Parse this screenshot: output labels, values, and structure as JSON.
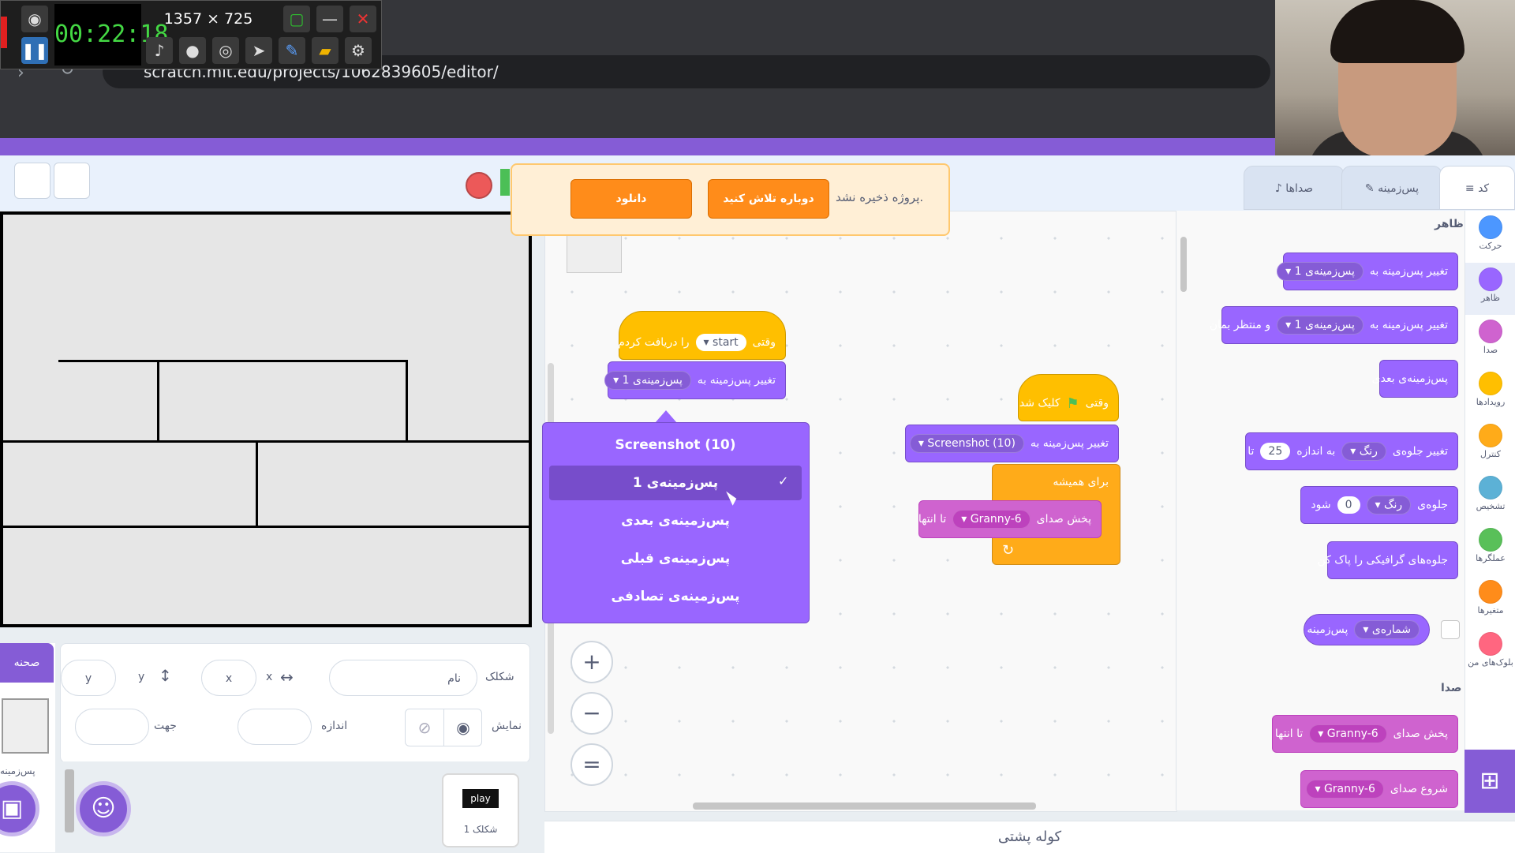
{
  "recorder": {
    "timer": "00:22:18",
    "size": "1357 × 725"
  },
  "browser": {
    "url": "scratch.mit.edu/projects/1062839605/editor/"
  },
  "notice": {
    "text": "پروژه ذخیره نشد.",
    "retry": "دوباره تلاش کنید",
    "download": "دانلود"
  },
  "tabs": {
    "code": "کد",
    "costumes": "پس‌زمینه",
    "sounds": "صداها"
  },
  "categories": [
    {
      "label": "حرکت",
      "color": "#4c97ff"
    },
    {
      "label": "ظاهر",
      "color": "#9966ff"
    },
    {
      "label": "صدا",
      "color": "#cf63cf"
    },
    {
      "label": "رویدادها",
      "color": "#ffbf00"
    },
    {
      "label": "کنترل",
      "color": "#ffab19"
    },
    {
      "label": "تشخیص",
      "color": "#5cb1d6"
    },
    {
      "label": "عملگرها",
      "color": "#59c059"
    },
    {
      "label": "متغیرها",
      "color": "#ff8c1a"
    },
    {
      "label": "بلوک‌های من",
      "color": "#ff6680"
    }
  ],
  "palette": {
    "looks_header": "ظاهر",
    "sound_header": "صدا",
    "b1": {
      "text": "تغییر پس‌زمینه به",
      "value": "پس‌زمینه‌ی 1"
    },
    "b2": {
      "text": "تغییر پس‌زمینه به",
      "value": "پس‌زمینه‌ی 1",
      "suffix": "و منتظر بمان"
    },
    "b3": {
      "text": "پس‌زمینه‌ی بعدی"
    },
    "b4": {
      "text": "تغییر جلوه‌ی",
      "option": "رنگ",
      "mid": "به اندازه",
      "num": "25",
      "suffix": "تا"
    },
    "b5": {
      "text": "جلوه‌ی",
      "option": "رنگ",
      "num": "0",
      "suffix": "شود"
    },
    "b6": {
      "text": "جلوه‌های گرافیکی را پاک کن"
    },
    "b7": {
      "option": "شماره‌ی",
      "suffix": "پس‌زمینه"
    },
    "s1": {
      "text": "پخش صدای",
      "value": "Granny-6",
      "suffix": "تا انتها"
    },
    "s2": {
      "text": "شروع صدای",
      "value": "Granny-6"
    }
  },
  "script1": {
    "hat": {
      "prefix": "وقتی",
      "value": "start",
      "suffix": "را دریافت کردم"
    },
    "switch": {
      "text": "تغییر پس‌زمینه به",
      "value": "پس‌زمینه‌ی 1"
    }
  },
  "dropdown": {
    "title": "Screenshot (10)",
    "items": [
      "پس‌زمینه‌ی 1",
      "پس‌زمینه‌ی بعدی",
      "پس‌زمینه‌ی قبلی",
      "پس‌زمینه‌ی تصادفی"
    ],
    "check": "✓"
  },
  "script2": {
    "hat": {
      "prefix": "وقتی",
      "suffix": "کلیک شد"
    },
    "switch": {
      "text": "تغییر پس‌زمینه به",
      "value": "Screenshot (10)"
    },
    "forever": "برای همیشه",
    "play": {
      "text": "پخش صدای",
      "value": "Granny-6",
      "suffix": "تا انتها"
    },
    "loop_arrow": "↻"
  },
  "sprite_info": {
    "sprite_label": "شکلک",
    "name_placeholder": "نام",
    "x_label": "x",
    "x_placeholder": "x",
    "y_label": "y",
    "y_placeholder": "y",
    "show_label": "نمایش",
    "size_label": "اندازه",
    "direction_label": "جهت"
  },
  "stage_panel": {
    "header": "صحنه",
    "backdrops_label": "پس‌زمینه"
  },
  "sprite": {
    "thumb_text": "play",
    "name": "شکلک 1"
  },
  "backpack": {
    "label": "کوله پشتی"
  },
  "zoom": {
    "in": "+",
    "out": "−",
    "reset": "="
  }
}
